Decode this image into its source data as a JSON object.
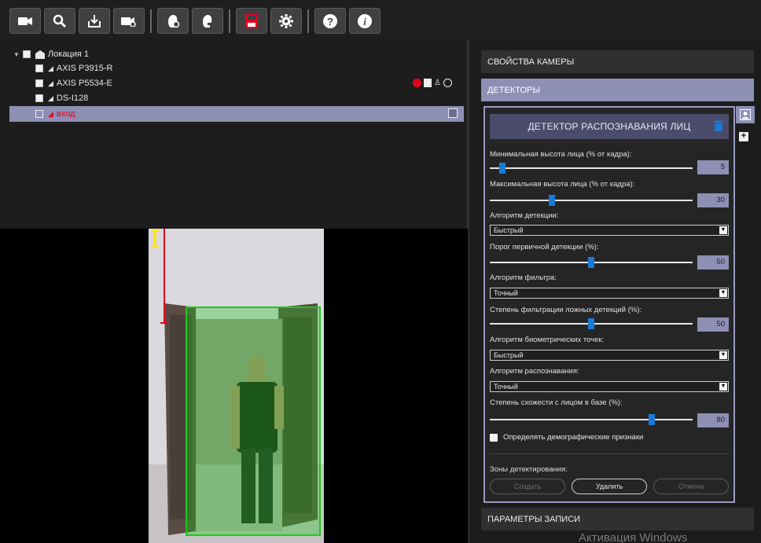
{
  "toolbar": {
    "buttons": [
      {
        "icon": "camera-icon"
      },
      {
        "icon": "search-icon"
      },
      {
        "icon": "download-icon"
      },
      {
        "icon": "camera-settings-icon"
      },
      {
        "icon": "face-add-icon"
      },
      {
        "icon": "face-remove-icon"
      },
      {
        "icon": "save-icon"
      },
      {
        "icon": "gear-icon"
      },
      {
        "icon": "help-icon"
      },
      {
        "icon": "info-icon"
      }
    ],
    "save_color": "#e4001c"
  },
  "tree": {
    "location": "Локация 1",
    "cameras": [
      {
        "name": "AXIS P3915-R"
      },
      {
        "name": "AXIS P5534-E"
      },
      {
        "name": "DS-I128"
      },
      {
        "name": "вход"
      }
    ]
  },
  "right_panel": {
    "camera_props": "СВОЙСТВА КАМЕРЫ",
    "detectors": "ДЕТЕКТОРЫ",
    "record_params": "ПАРАМЕТРЫ ЗАПИСИ",
    "detector": {
      "title": "ДЕТЕКТОР РАСПОЗНАВАНИЯ ЛИЦ",
      "min_height": {
        "label": "Минимальная высота лица (% от кадра):",
        "value": "5",
        "level": 0.05
      },
      "max_height": {
        "label": "Максимальная высота лица (% от кадра):",
        "value": "30",
        "level": 0.3
      },
      "detect_algo": {
        "label": "Алгоритм детекции:",
        "value": "Быстрый"
      },
      "primary_threshold": {
        "label": "Порог первичной детекции (%):",
        "value": "50",
        "level": 0.5
      },
      "filter_algo": {
        "label": "Алгоритм фильтра:",
        "value": "Точный"
      },
      "false_filter": {
        "label": "Степень фильтрации ложных детекций (%):",
        "value": "50",
        "level": 0.5
      },
      "biometric_algo": {
        "label": "Алгоритм биометрических точек:",
        "value": "Быстрый"
      },
      "recognition_algo": {
        "label": "Алгоритм распознавания:",
        "value": "Точный"
      },
      "similarity": {
        "label": "Степень схожести с лицом в базе (%):",
        "value": "80",
        "level": 0.8
      },
      "demographics": "Определять демографические признаки",
      "zones_label": "Зоны детектирования:",
      "zone_buttons": {
        "create": "Создать",
        "delete": "Удалить",
        "cancel": "Отмена"
      }
    }
  },
  "watermark": "Активация Windows",
  "colors": {
    "accent": "#8e8fb4",
    "slider": "#1a7ad8",
    "zone": "#1ec81e"
  }
}
